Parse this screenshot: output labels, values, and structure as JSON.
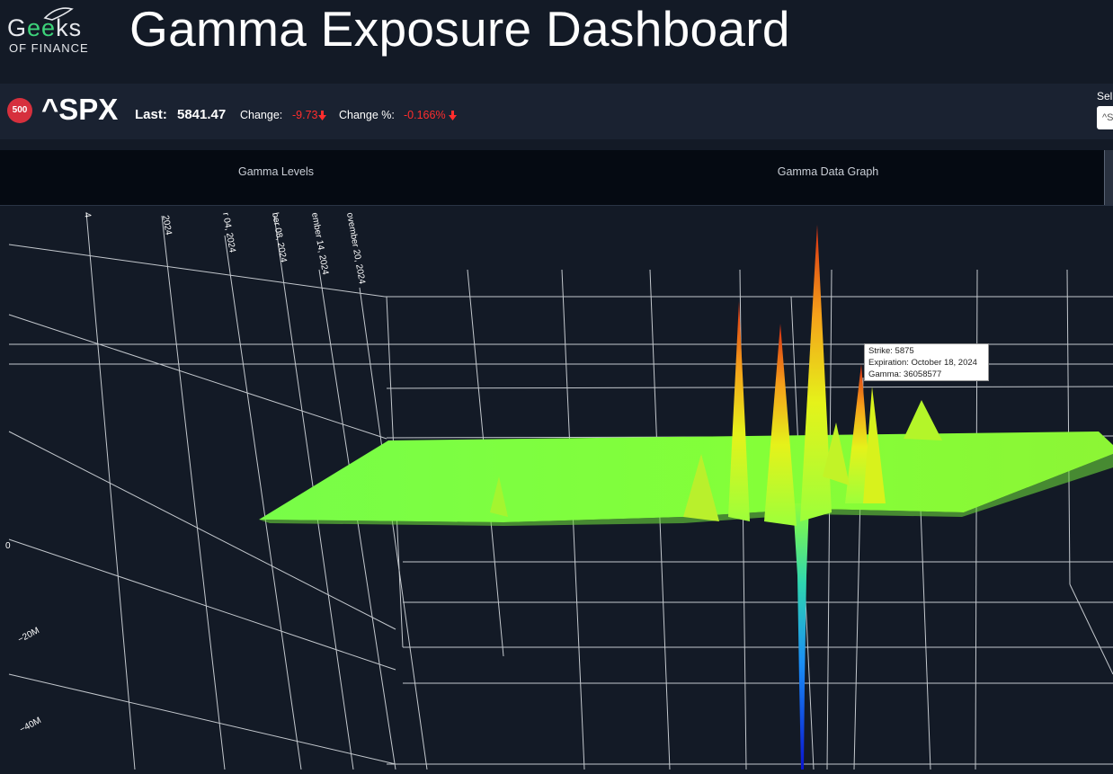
{
  "header": {
    "logo_top_prefix": "G",
    "logo_top_ee": "ee",
    "logo_top_suffix": "ks",
    "logo_bottom": "OF FINANCE",
    "title": "Gamma Exposure Dashboard"
  },
  "ticker": {
    "badge": "500",
    "symbol": "^SPX",
    "last_label": "Last:",
    "last_value": "5841.47",
    "change_label": "Change:",
    "change_value": "-9.73",
    "change_pct_label": "Change %:",
    "change_pct_value": "-0.166%",
    "select_label": "Sel",
    "select_value": "^S"
  },
  "tabs": [
    {
      "label": "Gamma Levels"
    },
    {
      "label": "Gamma Data Graph"
    }
  ],
  "chart": {
    "expiration_ticks": [
      "4",
      "2024",
      "r 04, 2024",
      "ber 08, 2024",
      "ember 14, 2024",
      "ovember 20, 2024"
    ],
    "z_ticks": [
      "0",
      "−20M",
      "−40M"
    ],
    "tooltip": {
      "strike": "Strike: 5875",
      "expiration": "Expiration: October 18, 2024",
      "gamma": "Gamma: 36058577"
    },
    "colors": {
      "surface_base": "#7dff3c",
      "peak_high": "#e13b14",
      "trough_low": "#0a1fd4"
    }
  },
  "chart_data": {
    "type": "surface3d",
    "title": "",
    "xlabel": "",
    "ylabel": "",
    "zlabel": "",
    "x_ticks": [
      "4",
      "2024",
      "r 04, 2024",
      "ber 08, 2024",
      "ember 14, 2024",
      "ovember 20, 2024"
    ],
    "z_ticks": [
      "0",
      "−20M",
      "−40M"
    ],
    "highlight_point": {
      "strike": 5875,
      "expiration": "October 18, 2024",
      "gamma": 36058577
    },
    "peaks": [
      {
        "gamma": 23000000
      },
      {
        "gamma": 19000000
      },
      {
        "gamma": 36058577
      },
      {
        "gamma": 13000000
      },
      {
        "gamma": 8000000
      },
      {
        "gamma": 3000000
      }
    ],
    "troughs": [
      {
        "gamma": -46000000
      }
    ]
  }
}
